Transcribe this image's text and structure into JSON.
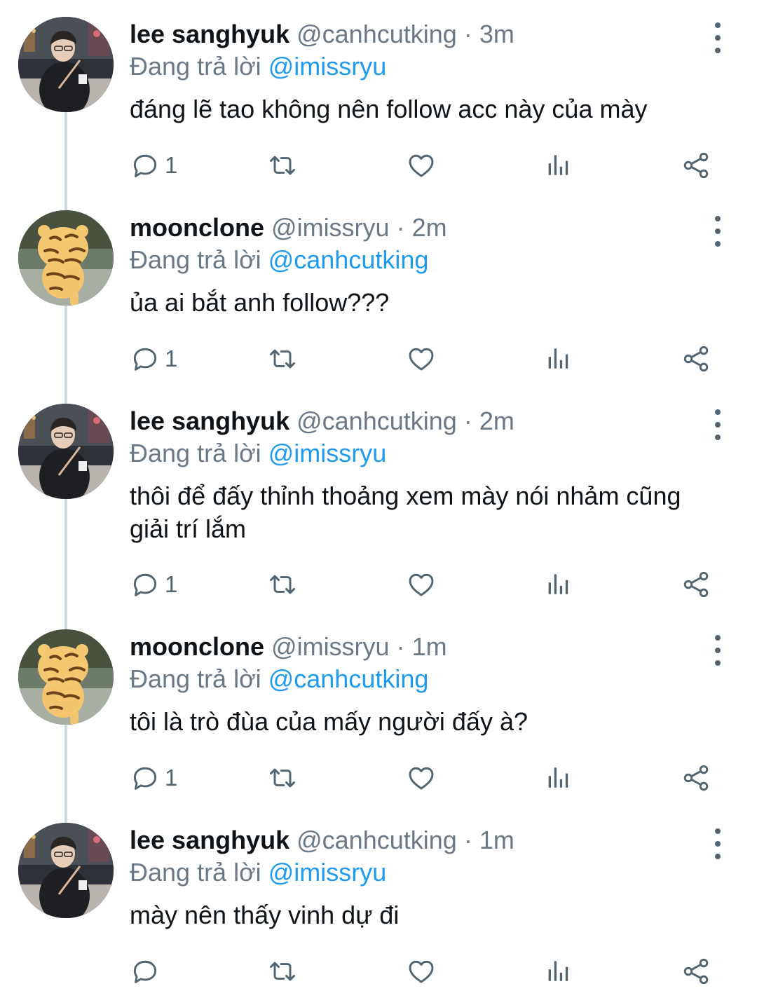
{
  "tweets": [
    {
      "name": "lee sanghyuk",
      "handle": "@canhcutking",
      "separator": "·",
      "time": "3m",
      "reply_prefix": "Đang trả lời",
      "reply_to": "@imissryu",
      "text": "đáng lẽ tao không nên follow acc này của mày",
      "reply_count": "1",
      "avatar": "photo-person-avatar"
    },
    {
      "name": "moonclone",
      "handle": "@imissryu",
      "separator": "·",
      "time": "2m",
      "reply_prefix": "Đang trả lời",
      "reply_to": "@canhcutking",
      "text": "ủa ai bắt anh follow???",
      "reply_count": "1",
      "avatar": "tiger-plush-avatar"
    },
    {
      "name": "lee sanghyuk",
      "handle": "@canhcutking",
      "separator": "·",
      "time": "2m",
      "reply_prefix": "Đang trả lời",
      "reply_to": "@imissryu",
      "text": "thôi để đấy thỉnh thoảng xem mày nói nhảm cũng giải trí lắm",
      "reply_count": "1",
      "avatar": "photo-person-avatar"
    },
    {
      "name": "moonclone",
      "handle": "@imissryu",
      "separator": "·",
      "time": "1m",
      "reply_prefix": "Đang trả lời",
      "reply_to": "@canhcutking",
      "text": "tôi là trò đùa của mấy người đấy à?",
      "reply_count": "1",
      "avatar": "tiger-plush-avatar"
    },
    {
      "name": "lee sanghyuk",
      "handle": "@canhcutking",
      "separator": "·",
      "time": "1m",
      "reply_prefix": "Đang trả lời",
      "reply_to": "@imissryu",
      "text": "mày nên thấy vinh dự đi",
      "reply_count": "",
      "avatar": "photo-person-avatar"
    }
  ],
  "colors": {
    "link": "#1d9bf0",
    "secondary_text": "#6b7885",
    "icon": "#536471",
    "thread_line": "#cfd9de"
  }
}
